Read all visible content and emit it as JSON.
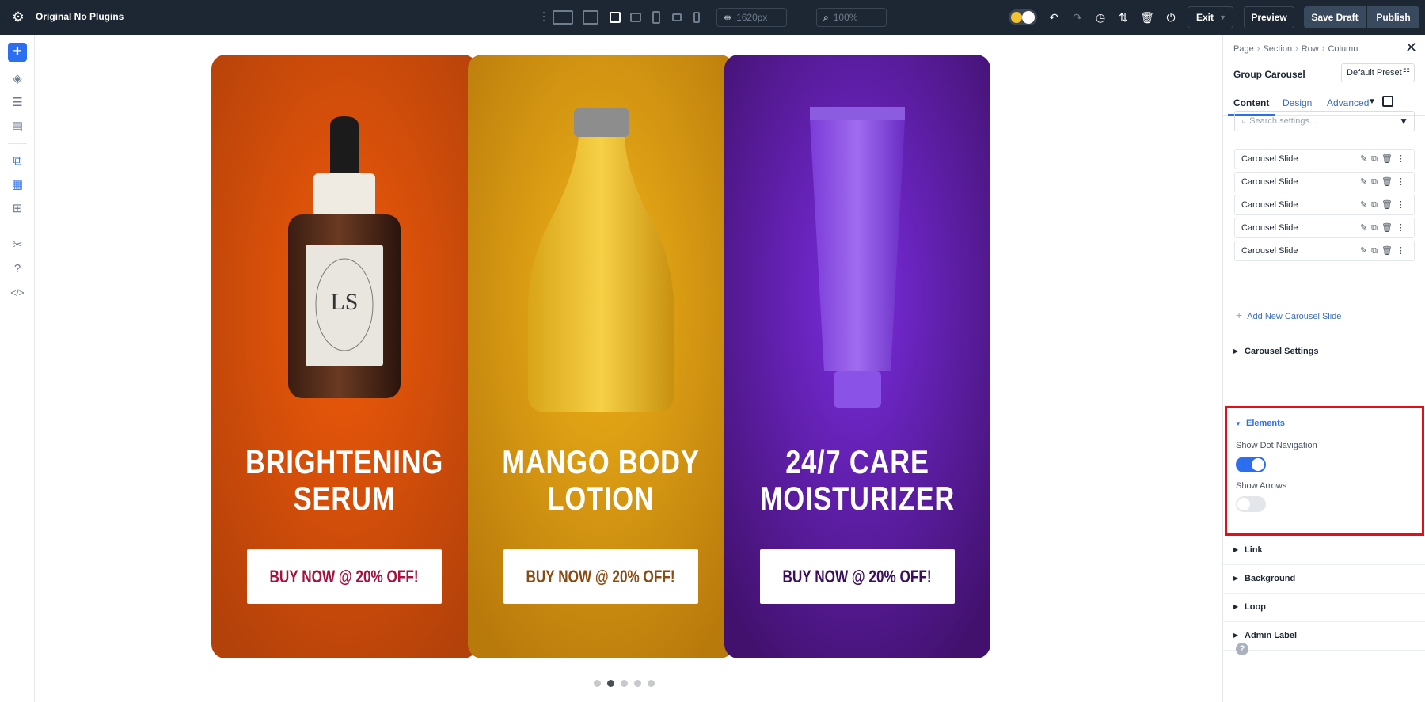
{
  "app": {
    "title": "Original No Plugins"
  },
  "topbar": {
    "width_value": "1620px",
    "zoom_value": "100%",
    "exit_label": "Exit",
    "preview_label": "Preview",
    "save_draft_label": "Save Draft",
    "publish_label": "Publish"
  },
  "canvas": {
    "cards": [
      {
        "title_line1": "BRIGHTENING",
        "title_line2": "SERUM",
        "button": "BUY NOW @ 20% OFF!",
        "button_color": "#a4123f",
        "bg_center": "#f05a0a",
        "bg_edge": "#b3410a",
        "label_monogram": "LS"
      },
      {
        "title_line1": "MANGO BODY",
        "title_line2": "LOTION",
        "button": "BUY NOW @ 20% OFF!",
        "button_color": "#8a4a10",
        "bg_center": "#f0b318",
        "bg_edge": "#b97a0c"
      },
      {
        "title_line1": "24/7 CARE",
        "title_line2": "MOISTURIZER",
        "button": "BUY NOW @ 20% OFF!",
        "button_color": "#3a0f5e",
        "bg_center": "#7a2ce0",
        "bg_edge": "#42116e"
      }
    ],
    "dots_total": 5,
    "dots_active_index": 1
  },
  "panel": {
    "breadcrumb": [
      "Page",
      "Section",
      "Row",
      "Column"
    ],
    "module_name": "Group Carousel",
    "preset": "Default Preset",
    "tabs": [
      "Content",
      "Design",
      "Advanced"
    ],
    "search_placeholder": "Search settings...",
    "slides": [
      "Carousel Slide",
      "Carousel Slide",
      "Carousel Slide",
      "Carousel Slide",
      "Carousel Slide"
    ],
    "add_slide_label": "Add New Carousel Slide",
    "section_carousel_settings": "Carousel Settings",
    "section_elements": "Elements",
    "show_dot_navigation_label": "Show Dot Navigation",
    "show_dot_navigation": true,
    "show_arrows_label": "Show Arrows",
    "show_arrows": false,
    "section_link": "Link",
    "section_background": "Background",
    "section_loop": "Loop",
    "section_admin_label": "Admin Label"
  },
  "colors": {
    "accent": "#2b6ef0",
    "topbar": "#1d2733",
    "highlight": "#e0101a"
  }
}
